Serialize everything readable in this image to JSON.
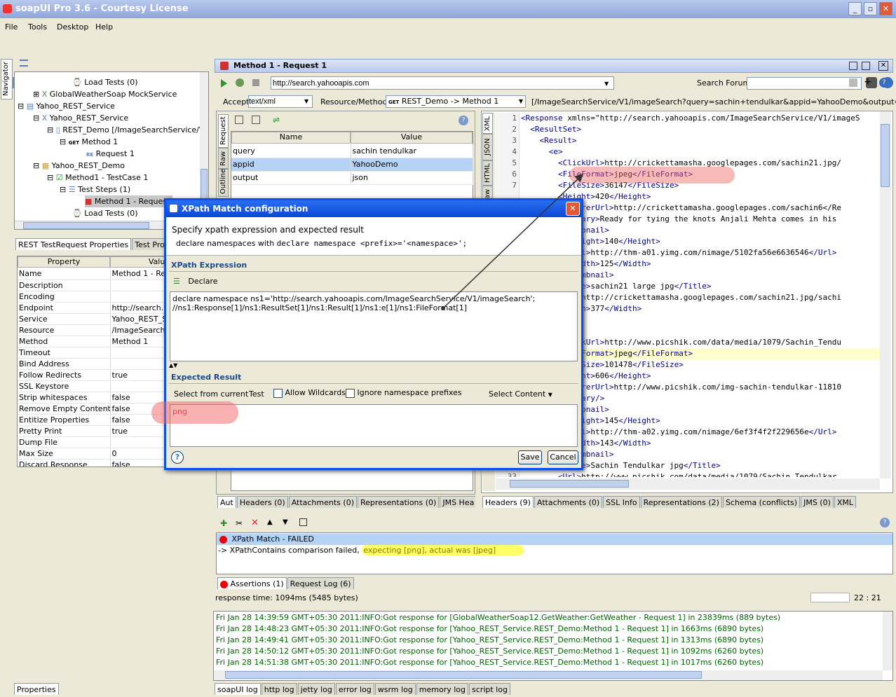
{
  "app": {
    "title": "soapUI Pro 3.6 - Courtesy License"
  },
  "menus": [
    "File",
    "Tools",
    "Desktop",
    "Help"
  ],
  "search": {
    "label": "Search Forum",
    "value": ""
  },
  "navigator_label": "Navigator",
  "tree": [
    {
      "label": "Load Tests (0)"
    },
    {
      "label": "GlobalWeatherSoap MockService"
    },
    {
      "label": "Yahoo_REST_Service"
    },
    {
      "label": "Yahoo_REST_Service"
    },
    {
      "label": "REST_Demo [/ImageSearchService/V1/"
    },
    {
      "label": "Method 1"
    },
    {
      "label": "Request 1"
    },
    {
      "label": "Yahoo_REST_Demo"
    },
    {
      "label": "Method1 - TestCase 1"
    },
    {
      "label": "Test Steps (1)"
    },
    {
      "label": "Method 1 - Request"
    },
    {
      "label": "Load Tests (0)"
    }
  ],
  "props_tabs": [
    "REST TestRequest Properties",
    "Test Pro"
  ],
  "props_headers": [
    "Property",
    "Value"
  ],
  "props": [
    [
      "Name",
      "Method 1 - Req"
    ],
    [
      "Description",
      ""
    ],
    [
      "Encoding",
      ""
    ],
    [
      "Endpoint",
      "http://search.y"
    ],
    [
      "Service",
      "Yahoo_REST_S"
    ],
    [
      "Resource",
      "/ImageSearchS"
    ],
    [
      "Method",
      "Method 1"
    ],
    [
      "Timeout",
      ""
    ],
    [
      "Bind Address",
      ""
    ],
    [
      "Follow Redirects",
      "true"
    ],
    [
      "SSL Keystore",
      ""
    ],
    [
      "Strip whitespaces",
      "false"
    ],
    [
      "Remove Empty Content",
      "false"
    ],
    [
      "Entitize Properties",
      "false"
    ],
    [
      "Pretty Print",
      "true"
    ],
    [
      "Dump File",
      ""
    ],
    [
      "Max Size",
      "0"
    ],
    [
      "Discard Response",
      "false"
    ]
  ],
  "props_footer_tab": "Properties",
  "editor": {
    "title": "Method 1 - Request 1",
    "endpoint": "http://search.yahooapis.com",
    "accept_label": "Accept",
    "accept_value": "text/xml",
    "resource_label": "Resource/Method:",
    "resource_value": "REST_Demo -> Method 1",
    "path": "[/ImageSearchService/V1/imageSearch?query=sachin+tendulkar&appid=YahooDemo&output=json]",
    "param_headers": [
      "Name",
      "Value"
    ],
    "params": [
      [
        "query",
        "sachin tendulkar"
      ],
      [
        "appid",
        "YahooDemo"
      ],
      [
        "output",
        "json"
      ]
    ],
    "req_vtabs": [
      "Request",
      "Raw",
      "Outline"
    ],
    "resp_vtabs": [
      "XML",
      "JSON",
      "HTML",
      "Raw"
    ],
    "req_tabs": [
      "Aut",
      "Headers (0)",
      "Attachments (0)",
      "Representations (0)",
      "JMS Hea"
    ],
    "resp_tabs": [
      "Headers (9)",
      "Attachments (0)",
      "SSL Info",
      "Representations (2)",
      "Schema (conflicts)",
      "JMS (0)",
      "XML"
    ]
  },
  "xml_lines": [
    {
      "n": "1",
      "t": "<Response xmlns=\"http://search.yahooapis.com/ImageSearchService/V1/imageS"
    },
    {
      "n": "2",
      "t": "  <ResultSet>"
    },
    {
      "n": "3",
      "t": "    <Result>"
    },
    {
      "n": "4",
      "t": "      <e>"
    },
    {
      "n": "5",
      "t": "        <ClickUrl>http://crickettamasha.googlepages.com/sachin21.jpg/"
    },
    {
      "n": "6",
      "t": "        <FileFormat>jpeg</FileFormat>"
    },
    {
      "n": "7",
      "t": "        <FileSize>36147</FileSize>"
    },
    {
      "n": "",
      "t": "        <Height>420</Height>"
    },
    {
      "n": "",
      "t": "        <RefererUrl>http://crickettamasha.googlepages.com/sachin6</Re"
    },
    {
      "n": "",
      "t": "        <Summary>Ready for tying the knots Anjali Mehta comes in his"
    },
    {
      "n": "",
      "t": "        <Thumbnail>"
    },
    {
      "n": "",
      "t": "          <Height>140</Height>"
    },
    {
      "n": "",
      "t": "          <Url>http://thm-a01.yimg.com/nimage/5102fa56e6636546</Url>"
    },
    {
      "n": "",
      "t": "          <Width>125</Width>"
    },
    {
      "n": "",
      "t": "        </Thumbnail>"
    },
    {
      "n": "",
      "t": "        <Title>sachin21 large jpg</Title>"
    },
    {
      "n": "",
      "t": "        <Url>http://crickettamasha.googlepages.com/sachin21.jpg/sachi"
    },
    {
      "n": "",
      "t": "        <Width>377</Width>"
    },
    {
      "n": "",
      "t": ""
    },
    {
      "n": "",
      "t": ""
    },
    {
      "n": "",
      "t": "        <ClickUrl>http://www.picshik.com/data/media/1079/Sachin_Tendu"
    },
    {
      "n": "",
      "t": "        <FileFormat>jpeg</FileFormat>"
    },
    {
      "n": "",
      "t": "        <FileSize>101478</FileSize>"
    },
    {
      "n": "",
      "t": "        <Height>606</Height>"
    },
    {
      "n": "",
      "t": "        <RefererUrl>http://www.picshik.com/img-sachin-tendulkar-11810"
    },
    {
      "n": "",
      "t": "        <Summary/>"
    },
    {
      "n": "",
      "t": "        <Thumbnail>"
    },
    {
      "n": "",
      "t": "          <Height>145</Height>"
    },
    {
      "n": "",
      "t": "          <Url>http://thm-a02.yimg.com/nimage/6ef3f4f2f229656e</Url>"
    },
    {
      "n": "",
      "t": "          <Width>143</Width>"
    },
    {
      "n": "",
      "t": "        </Thumbnail>"
    },
    {
      "n": "",
      "t": "        <Title>Sachin Tendulkar jpg</Title>"
    },
    {
      "n": "33",
      "t": "        <Url>http://www.picshik.com/data/media/1079/Sachin_Tendulkar"
    }
  ],
  "dialog": {
    "title": "XPath Match configuration",
    "heading": "Specify xpath expression and expected result",
    "sub_prefix": "declare namespaces with ",
    "sub_code": "declare namespace <prefix>='<namespace>';",
    "xpath_section": "XPath Expression",
    "declare_btn": "Declare",
    "xpath_line1": "declare namespace ns1='http://search.yahooapis.com/ImageSearchService/V1/imageSearch';",
    "xpath_line2": "//ns1:Response[1]/ns1:ResultSet[1]/ns1:Result[1]/ns1:e[1]/ns1:FileFormat[1]",
    "expected_section": "Expected Result",
    "select_from_current": "Select from current",
    "test": "Test",
    "allow_wildcards": "Allow Wildcards",
    "ignore_ns": "Ignore namespace prefixes",
    "select_content": "Select Content",
    "expected_value": "png",
    "save": "Save",
    "cancel": "Cancel"
  },
  "assertions": {
    "item": "XPath Match - FAILED",
    "detail_prefix": "-> XPathContains comparison failed, ",
    "detail_highlight": "expecting [png], actual was [jpeg]",
    "tabs": [
      "Assertions (1)",
      "Request Log (6)"
    ]
  },
  "status": {
    "response_time": "response time: 1094ms (5485 bytes)",
    "position": "22 : 21"
  },
  "log_lines": [
    "Fri Jan 28 14:39:59 GMT+05:30 2011:INFO:Got response for [GlobalWeatherSoap12.GetWeather:GetWeather - Request 1] in 23839ms (889 bytes)",
    "Fri Jan 28 14:48:23 GMT+05:30 2011:INFO:Got response for [Yahoo_REST_Service.REST_Demo:Method 1 - Request 1] in 1663ms (6890 bytes)",
    "Fri Jan 28 14:49:41 GMT+05:30 2011:INFO:Got response for [Yahoo_REST_Service.REST_Demo:Method 1 - Request 1] in 1313ms (6890 bytes)",
    "Fri Jan 28 14:50:12 GMT+05:30 2011:INFO:Got response for [Yahoo_REST_Service.REST_Demo:Method 1 - Request 1] in 1092ms (6260 bytes)",
    "Fri Jan 28 14:51:38 GMT+05:30 2011:INFO:Got response for [Yahoo_REST_Service.REST_Demo:Method 1 - Request 1] in 1017ms (6260 bytes)"
  ],
  "log_tabs": [
    "soapUI log",
    "http log",
    "jetty log",
    "error log",
    "wsrm log",
    "memory log",
    "script log"
  ],
  "colors": {
    "title_blue": "#0b47d6",
    "highlight_red": "#f08080",
    "highlight_yellow": "#ffff66",
    "log_green": "#006400"
  }
}
